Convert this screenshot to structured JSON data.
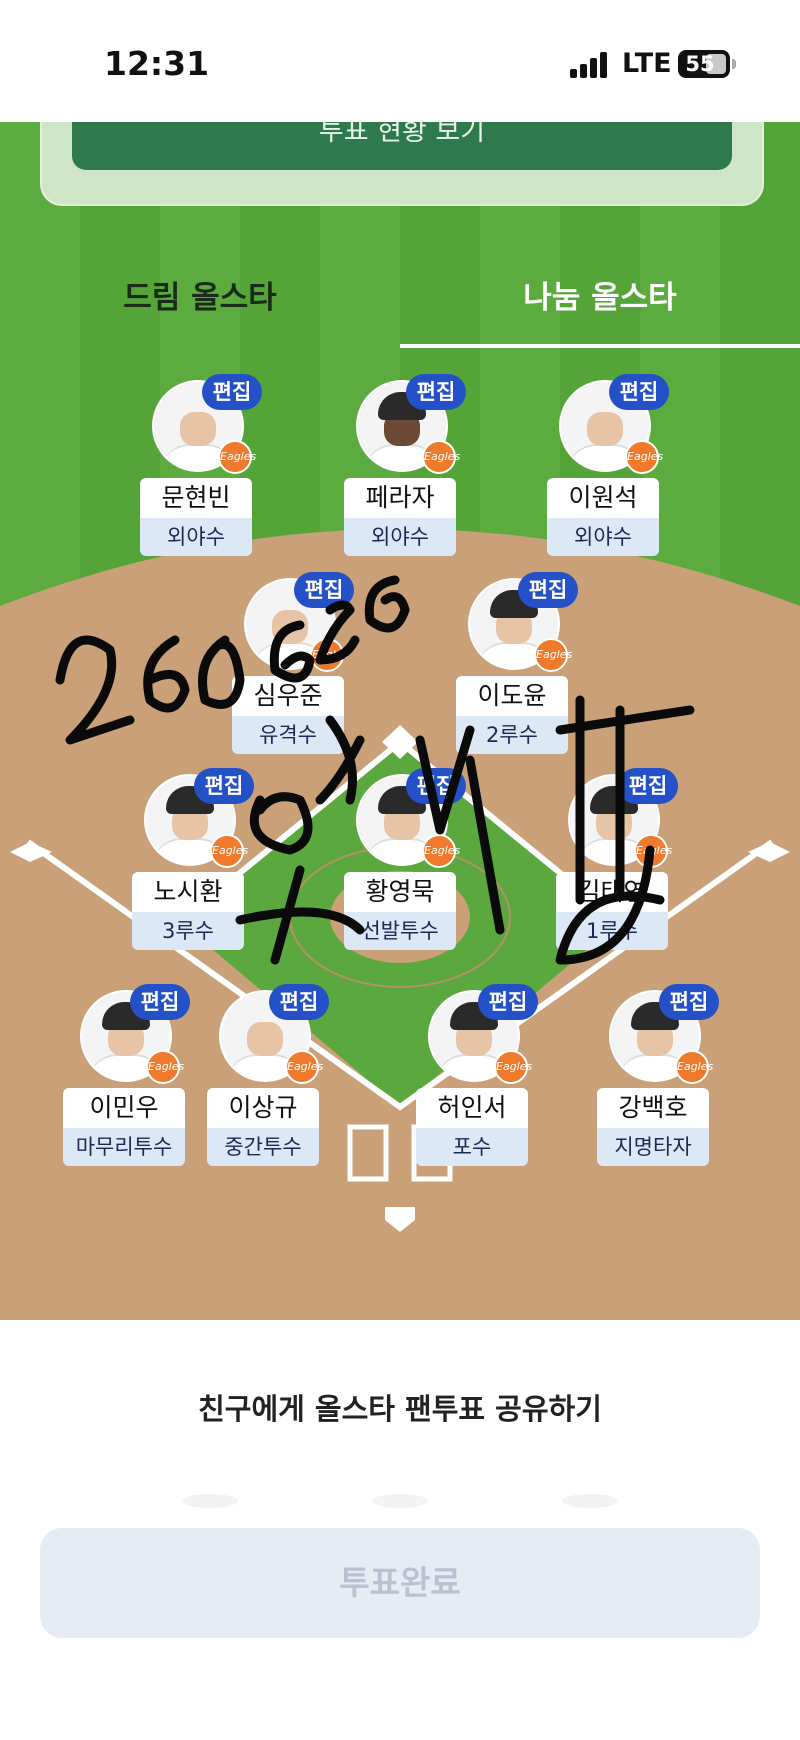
{
  "status_bar": {
    "time": "12:31",
    "network": "LTE",
    "battery": "55"
  },
  "vote_card": {
    "status_button": "투표 현황 보기"
  },
  "tabs": [
    {
      "label": "드림 올스타",
      "active": false
    },
    {
      "label": "나눔 올스타",
      "active": true
    }
  ],
  "edit_label": "편집",
  "team_logo": "Eagles",
  "players": [
    {
      "name": "문현빈",
      "position": "외야수"
    },
    {
      "name": "페라자",
      "position": "외야수"
    },
    {
      "name": "이원석",
      "position": "외야수"
    },
    {
      "name": "심우준",
      "position": "유격수"
    },
    {
      "name": "이도윤",
      "position": "2루수"
    },
    {
      "name": "노시환",
      "position": "3루수"
    },
    {
      "name": "황영묵",
      "position": "선발투수"
    },
    {
      "name": "김태연",
      "position": "1루수"
    },
    {
      "name": "이민우",
      "position": "마무리투수"
    },
    {
      "name": "이상규",
      "position": "중간투수"
    },
    {
      "name": "허인서",
      "position": "포수"
    },
    {
      "name": "강백호",
      "position": "지명타자"
    }
  ],
  "share": {
    "label": "친구에게 올스타 팬투표 공유하기"
  },
  "complete_button": {
    "label": "투표완료"
  },
  "colors": {
    "grass": "#5cab3f",
    "dirt": "#c9a077",
    "edit_badge": "#2450c8",
    "position_box": "#dde8f7",
    "vote_button": "#2f7a4d",
    "complete_button": "#e7ebf3"
  }
}
